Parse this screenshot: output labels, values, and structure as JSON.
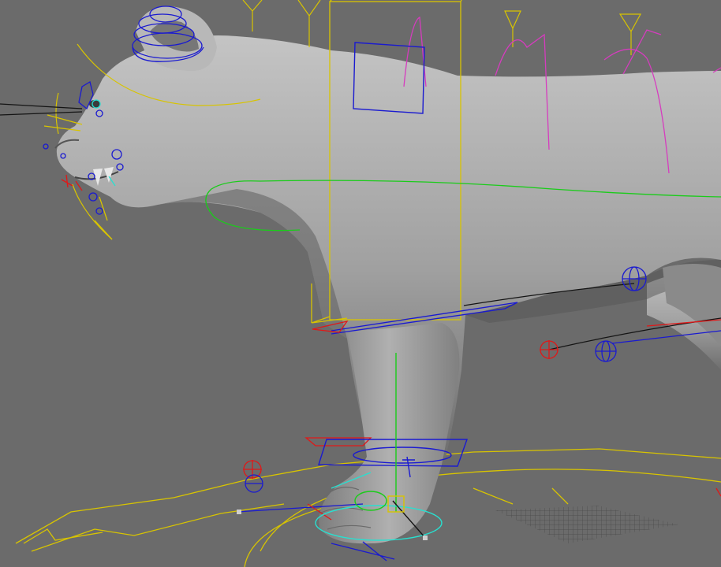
{
  "viewport": {
    "name": "3D rig viewport",
    "colors": {
      "background": "#6b6b6b",
      "model": "#9c9c9c",
      "model_highlight": "#b8b8b8",
      "model_shadow": "#5e5e5e",
      "control_yellow": "#d8c400",
      "control_blue": "#1a1ad0",
      "control_red": "#e01818",
      "control_green": "#1acc1a",
      "control_pink": "#d63cbf",
      "control_cyan": "#28e0d0",
      "line_black": "#141414"
    },
    "icons": [
      "lioness-model",
      "ear-controller",
      "head-arc-control",
      "face-controls",
      "neck-curve-control",
      "shoulder-box-control",
      "spine-controls",
      "foot-ik-control",
      "ground-arrow-control",
      "grid-patch"
    ]
  }
}
